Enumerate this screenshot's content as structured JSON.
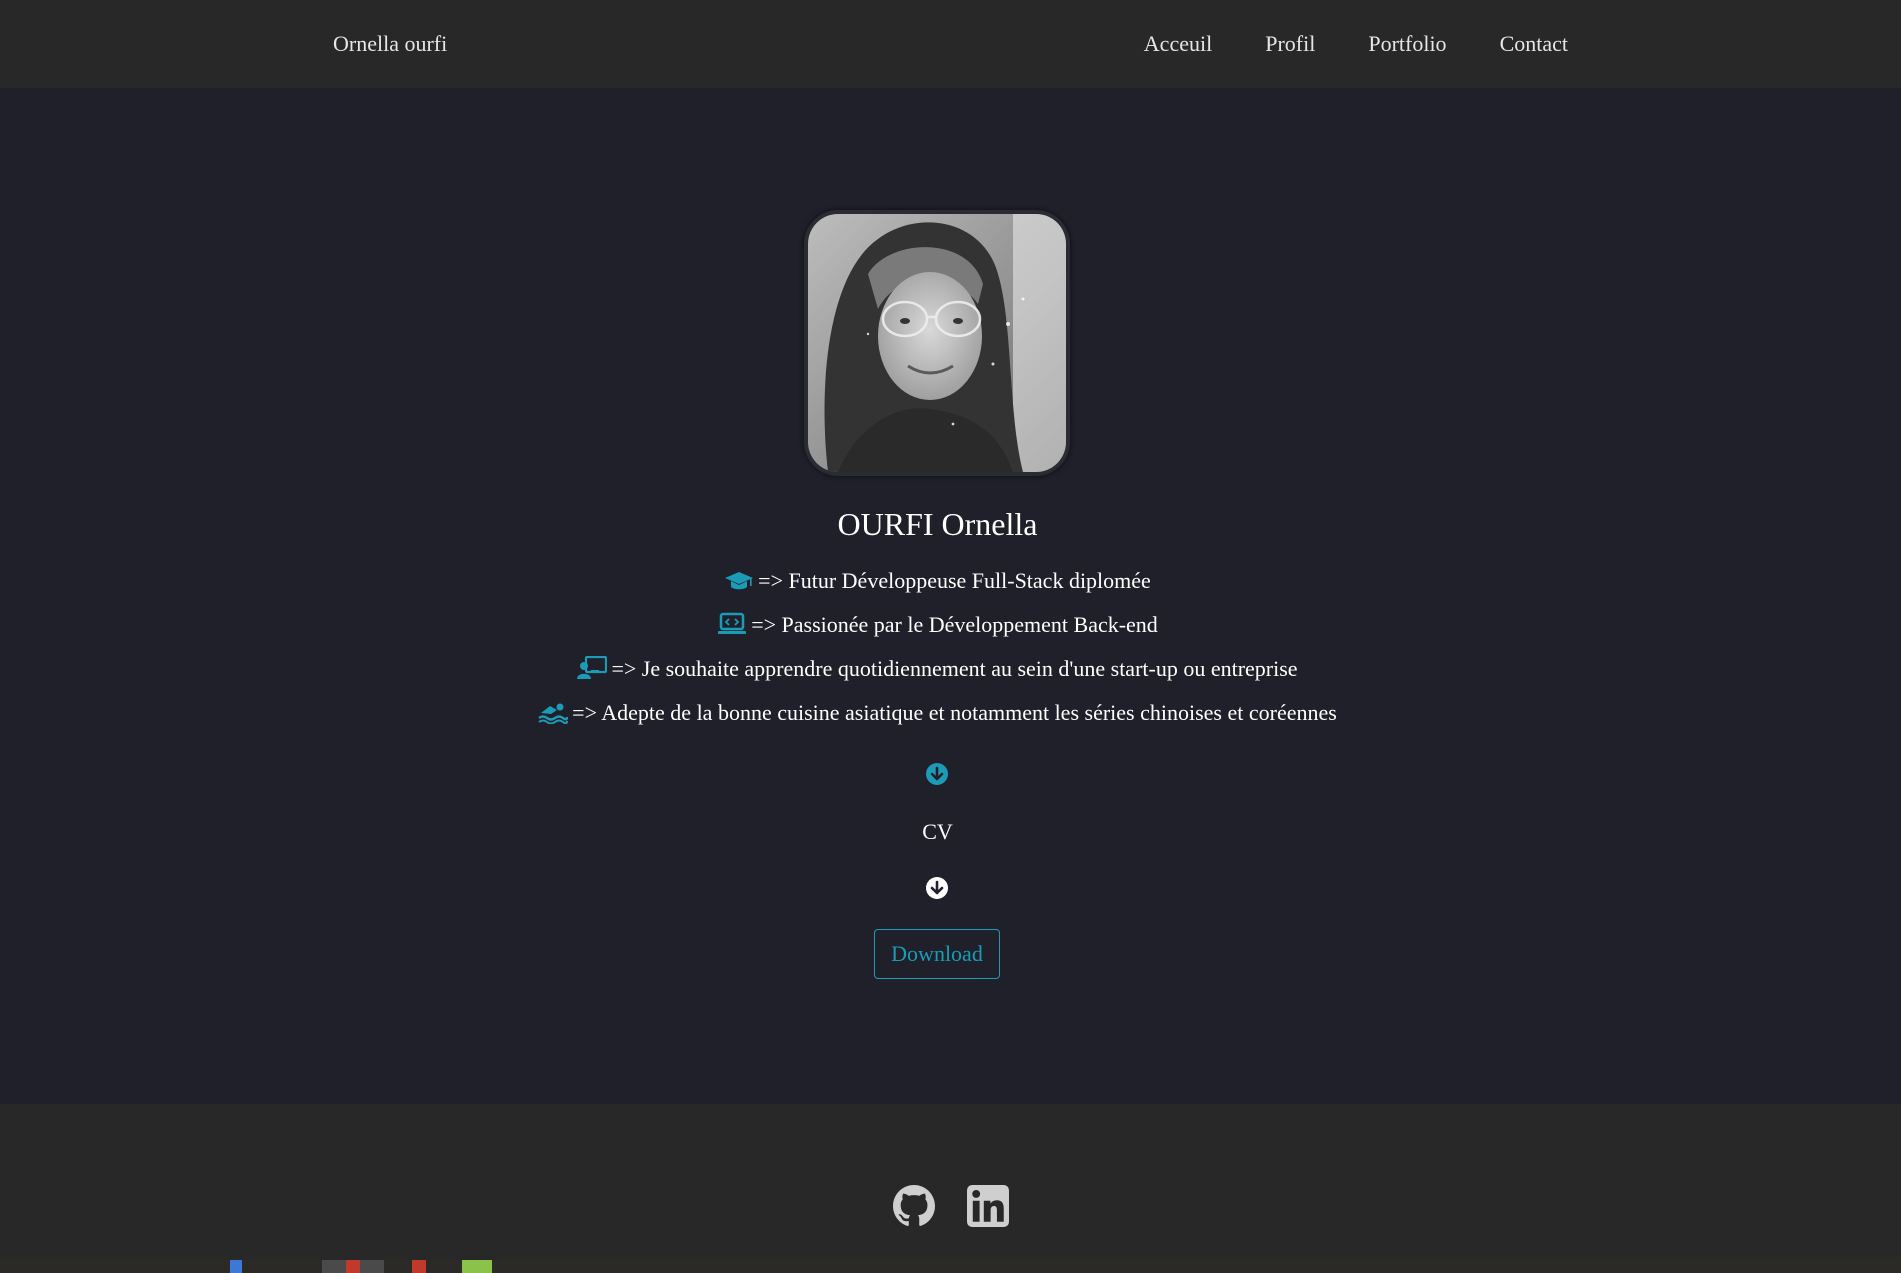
{
  "navbar": {
    "brand": "Ornella ourfi",
    "links": [
      {
        "label": "Acceuil"
      },
      {
        "label": "Profil"
      },
      {
        "label": "Portfolio"
      },
      {
        "label": "Contact"
      }
    ]
  },
  "profile": {
    "name": "OURFI Ornella",
    "bullets": [
      {
        "icon": "graduation-cap-icon",
        "text": "=> Futur Développeuse Full-Stack diplomée"
      },
      {
        "icon": "laptop-code-icon",
        "text": "=> Passionée par le Développement Back-end"
      },
      {
        "icon": "chalkboard-teacher-icon",
        "text": "=> Je souhaite apprendre quotidiennement au sein d'une start-up ou entreprise"
      },
      {
        "icon": "swimmer-icon",
        "text": "=> Adepte de la bonne cuisine asiatique et notamment les séries chinoises et coréennes"
      }
    ]
  },
  "cv": {
    "label": "CV",
    "download_label": "Download"
  },
  "footer": {
    "links": [
      {
        "icon": "github-icon"
      },
      {
        "icon": "linkedin-icon"
      }
    ]
  },
  "colors": {
    "accent": "#1c9bb7",
    "page_bg": "#1f202a",
    "bar_bg": "#282828",
    "text": "#ffffff",
    "nav_text": "#e6e6e6"
  }
}
